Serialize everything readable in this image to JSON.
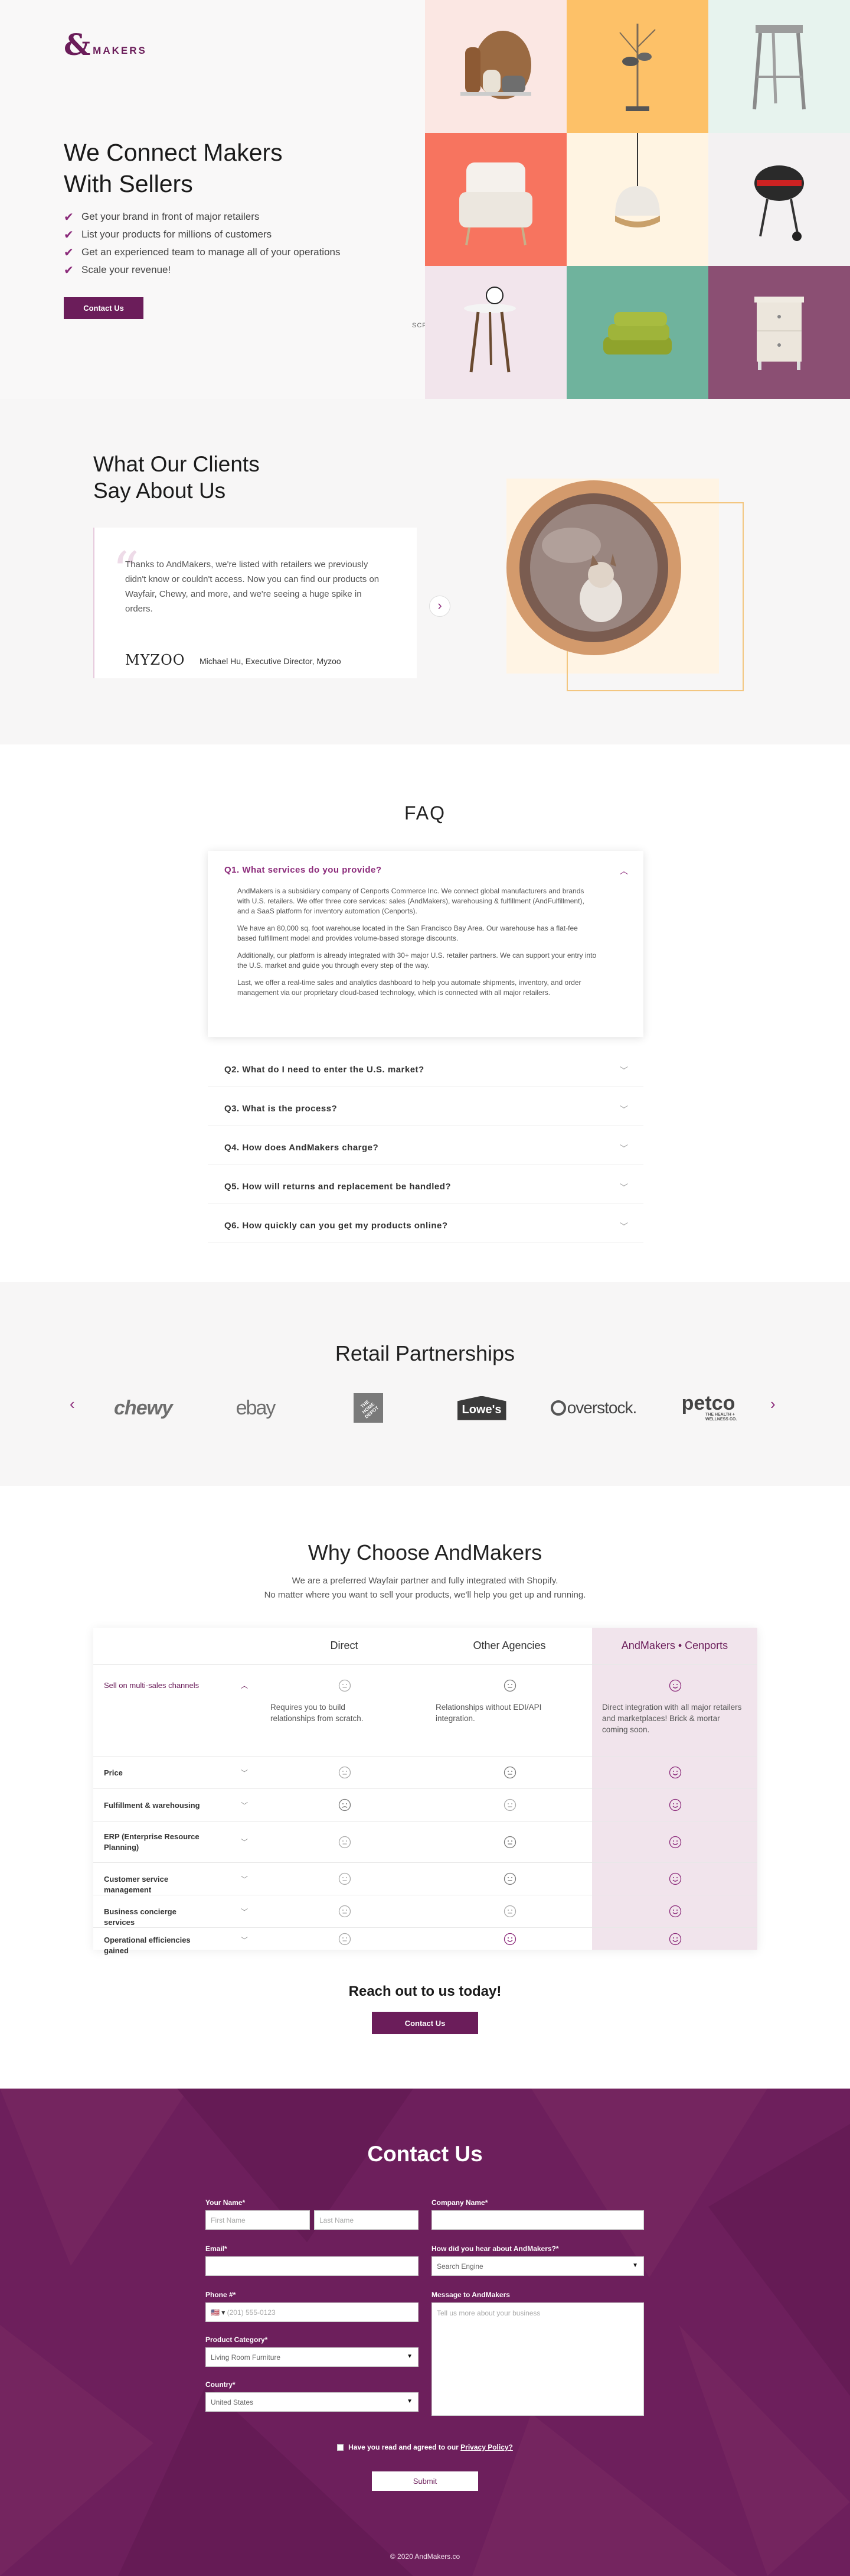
{
  "header": {
    "logo_symbol": "&",
    "logo_text": "MAKERS"
  },
  "hero": {
    "title": "We Connect Makers With Sellers",
    "bullets": [
      "Get your brand in front of major retailers",
      "List your products for millions of customers",
      "Get an experienced team to manage all of your operations",
      "Scale your revenue!"
    ],
    "cta": "Contact Us",
    "scroll_label": "SCROLL",
    "tile_colors": [
      "#fbe7e3",
      "#fdc168",
      "#e7f3ee",
      "#f7745f",
      "#fff4e2",
      "#f3f1f2",
      "#f2e5ec",
      "#6fb39d",
      "#8b4f73"
    ]
  },
  "testimonials": {
    "title": "What Our Clients Say About Us",
    "quote": "Thanks to AndMakers, we're listed with retailers we previously didn't know or couldn't access. Now you can find our products on Wayfair, Chewy, and more, and we're seeing a huge spike in orders.",
    "brand": "MYZOO",
    "author": "Michael Hu, Executive Director, Myzoo",
    "next": "›"
  },
  "faq": {
    "title": "FAQ",
    "open": {
      "question": "Q1. What services do you provide?",
      "answer": [
        "AndMakers is a subsidiary company of Cenports Commerce Inc. We connect global manufacturers and brands with U.S. retailers. We offer three core services: sales (AndMakers), warehousing & fulfillment (AndFulfillment), and a SaaS platform for inventory automation (Cenports).",
        "We have an 80,000 sq. foot warehouse located in the San Francisco Bay Area. Our warehouse has a flat-fee based fulfillment model and provides volume-based storage discounts.",
        "Additionally, our platform is already integrated with 30+ major U.S. retailer partners. We can support your entry into the U.S. market and guide you through every step of the way.",
        "Last, we offer a real-time sales and analytics dashboard to help you automate shipments, inventory, and order management via our proprietary cloud-based technology, which is connected with all major retailers."
      ]
    },
    "items": [
      "Q2. What do I need to enter the U.S. market?",
      "Q3. What is the process?",
      "Q4. How does AndMakers charge?",
      "Q5. How will returns and replacement be handled?",
      "Q6. How quickly can you get my products online?"
    ]
  },
  "retail": {
    "title": "Retail Partnerships",
    "logos": [
      "chewy",
      "ebay",
      "THE HOME DEPOT",
      "Lowe's",
      "overstock.",
      "petco"
    ],
    "petco_tagline": "THE HEALTH + WELLNESS CO."
  },
  "why": {
    "title": "Why Choose AndMakers",
    "subtitle_1": "We are a preferred Wayfair partner and fully integrated with Shopify.",
    "subtitle_2": "No matter where you want to sell your products, we'll help you get up and running.",
    "columns": [
      "Direct",
      "Other Agencies",
      "AndMakers • Cenports"
    ],
    "rows": [
      {
        "label": "Sell on multi-sales channels",
        "faces": [
          "neutral",
          "neutral",
          "happy"
        ],
        "notes": [
          "Requires you to build relationships from scratch.",
          "Relationships without EDI/API integration.",
          "Direct integration with all major retailers and marketplaces! Brick & mortar coming soon."
        ]
      },
      {
        "label": "Price",
        "faces": [
          "neutral",
          "neutral",
          "happy"
        ]
      },
      {
        "label": "Fulfillment & warehousing",
        "faces": [
          "sad",
          "neutral",
          "happy"
        ]
      },
      {
        "label": "ERP (Enterprise Resource Planning)",
        "faces": [
          "neutral",
          "neutral",
          "happy"
        ]
      },
      {
        "label": "Customer service management",
        "faces": [
          "neutral",
          "neutral",
          "happy"
        ]
      },
      {
        "label": "Business concierge services",
        "faces": [
          "neutral",
          "neutral",
          "happy"
        ]
      },
      {
        "label": "Operational efficiencies gained",
        "faces": [
          "neutral",
          "happy",
          "happy"
        ]
      }
    ],
    "reach": "Reach out to us today!",
    "cta": "Contact Us"
  },
  "contact": {
    "title": "Contact Us",
    "name_label": "Your Name*",
    "first_ph": "First Name",
    "last_ph": "Last Name",
    "company_label": "Company Name*",
    "email_label": "Email*",
    "hear_label": "How did you hear about AndMakers?*",
    "hear_value": "Search Engine",
    "phone_label": "Phone #*",
    "phone_ph": "(201) 555-0123",
    "message_label": "Message to AndMakers",
    "message_ph": "Tell us more about your business",
    "category_label": "Product Category*",
    "category_value": "Living Room Furniture",
    "country_label": "Country*",
    "country_value": "United States",
    "agree_text": "Have you read and agreed to our ",
    "agree_link": "Privacy Policy?",
    "submit": "Submit",
    "copyright": "© 2020 AndMakers.co"
  }
}
